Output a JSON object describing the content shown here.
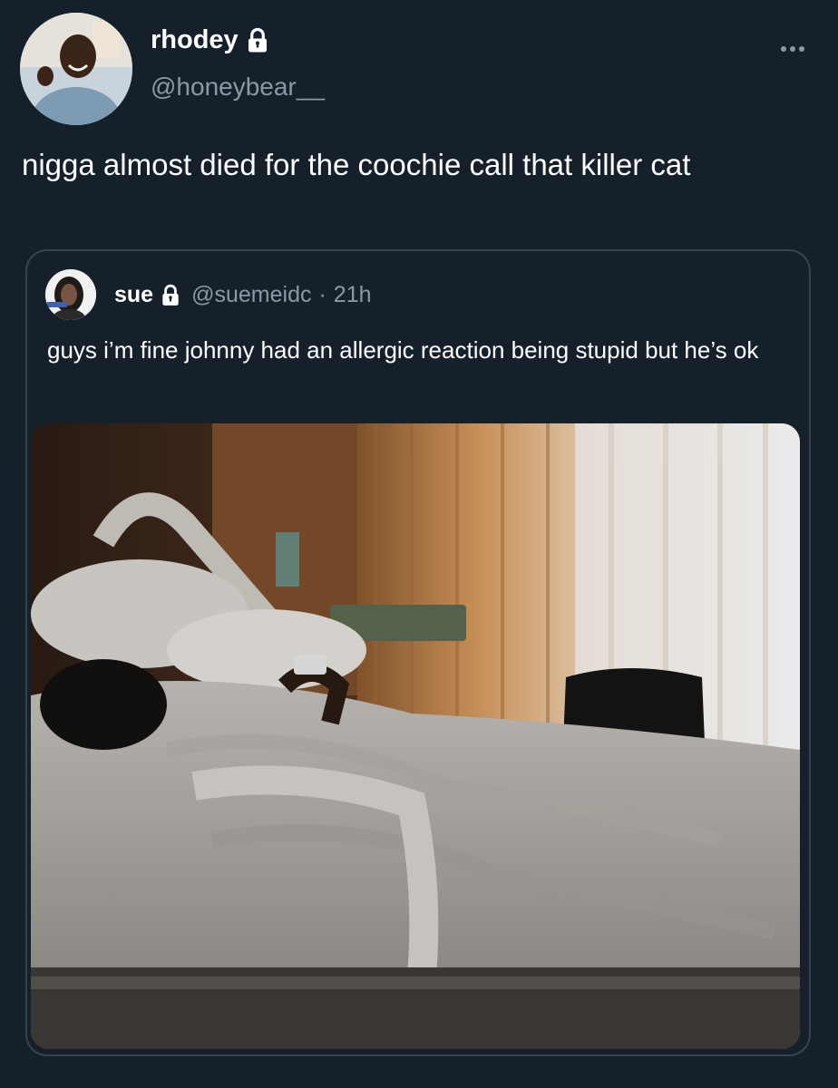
{
  "tweet": {
    "author": {
      "display_name": "rhodey",
      "handle": "@honeybear__",
      "protected": true,
      "avatar_icon": "avatar-photo"
    },
    "text": "nigga almost died for the coochie call that killer cat",
    "more_icon": "more-horizontal-icon"
  },
  "quoted_tweet": {
    "author": {
      "display_name": "sue",
      "handle": "@suemeidc",
      "protected": true,
      "avatar_icon": "avatar-photo"
    },
    "separator": "·",
    "time": "21h",
    "text": "guys i’m fine johnny had an allergic reaction being stupid but he’s ok",
    "media_icon": "photo-hospital-room"
  },
  "colors": {
    "background": "#15202b",
    "text_primary": "#ffffff",
    "text_secondary": "#8b98a5",
    "border": "#38444d"
  }
}
